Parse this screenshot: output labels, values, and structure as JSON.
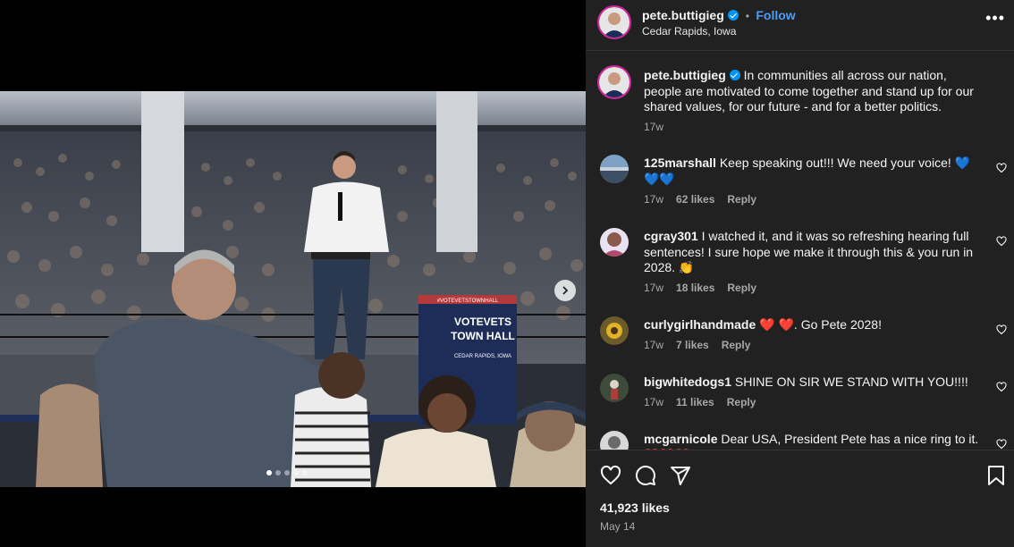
{
  "post": {
    "username": "pete.buttigieg",
    "follow_label": "Follow",
    "separator": "•",
    "location": "Cedar Rapids, Iowa",
    "more_label": "•••",
    "caption": "In communities all across our nation, people are motivated to come together and stand up for our shared values, for our future - and for a better politics.",
    "caption_time": "17w",
    "likes": "41,923 likes",
    "date": "May 14"
  },
  "media": {
    "podium_line1": "VOTEVETS",
    "podium_line2": "TOWN HALL",
    "podium_sub": "CEDAR RAPIDS, IOWA",
    "podium_top": "#VOTEVETSTOWNHALL",
    "slide_count": 5,
    "active_slide": 1
  },
  "comments": [
    {
      "user": "125marshall",
      "text": "Keep speaking out!!! We need your voice! 💙 💙💙",
      "time": "17w",
      "likes": "62 likes",
      "reply": "Reply"
    },
    {
      "user": "cgray301",
      "text": "I watched it, and it was so refreshing hearing full sentences! I sure hope we make it through this & you run in 2028. 👏",
      "time": "17w",
      "likes": "18 likes",
      "reply": "Reply"
    },
    {
      "user": "curlygirlhandmade",
      "text": "❤️ ❤️. Go Pete 2028!",
      "time": "17w",
      "likes": "7 likes",
      "reply": "Reply"
    },
    {
      "user": "bigwhitedogs1",
      "text": "SHINE ON SIR WE STAND WITH YOU!!!!",
      "time": "17w",
      "likes": "11 likes",
      "reply": "Reply"
    },
    {
      "user": "mcgarnicole",
      "text": "Dear USA, President Pete has a nice ring to it. ❤️❤️❤️",
      "time": "",
      "likes": "",
      "reply": ""
    }
  ],
  "icons": {
    "like": "heart-icon",
    "comment": "comment-icon",
    "share": "share-icon",
    "save": "bookmark-icon",
    "more": "more-icon",
    "next": "chevron-right-icon"
  },
  "colors": {
    "panel_bg": "#212121",
    "link": "#4e9df5",
    "verified": "#0095f6",
    "muted": "#a8a8a8"
  }
}
